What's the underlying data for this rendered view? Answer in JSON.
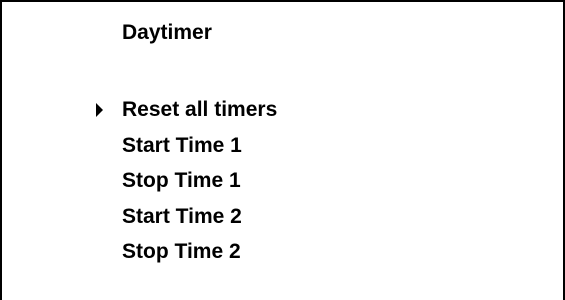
{
  "screen": {
    "title": "Daytimer",
    "selected_index": 0,
    "menu": {
      "items": [
        {
          "label": "Reset all timers"
        },
        {
          "label": "Start Time 1"
        },
        {
          "label": "Stop Time 1"
        },
        {
          "label": "Start Time 2"
        },
        {
          "label": "Stop Time 2"
        }
      ]
    },
    "cursor_icon": "triangle-right-icon"
  }
}
